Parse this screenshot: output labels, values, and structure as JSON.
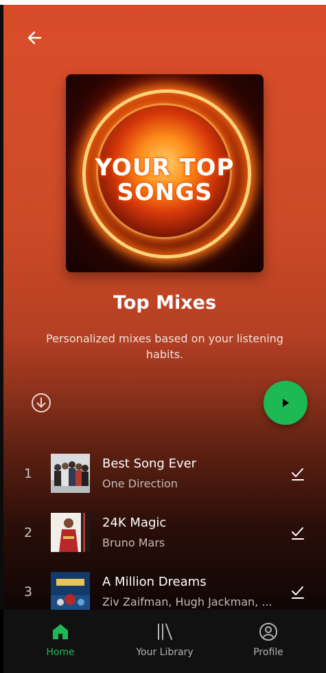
{
  "playlist": {
    "cover_text_line1": "YOUR TOP",
    "cover_text_line2": "SONGS",
    "title": "Top Mixes",
    "description": "Personalized mixes based on your listening habits."
  },
  "tracks": [
    {
      "number": "1",
      "title": "Best Song Ever",
      "artist": "One Direction"
    },
    {
      "number": "2",
      "title": "24K Magic",
      "artist": "Bruno Mars"
    },
    {
      "number": "3",
      "title": "A Million Dreams",
      "artist": "Ziv Zaifman, Hugh Jackman, ..."
    }
  ],
  "nav": {
    "home": "Home",
    "library": "Your Library",
    "profile": "Profile"
  },
  "colors": {
    "accent": "#1db954",
    "header_orange": "#d74b28",
    "nav_bg": "#111111"
  },
  "icons": [
    "back-arrow-icon",
    "download-icon",
    "play-icon",
    "check-icon",
    "home-icon",
    "library-icon",
    "profile-icon"
  ]
}
